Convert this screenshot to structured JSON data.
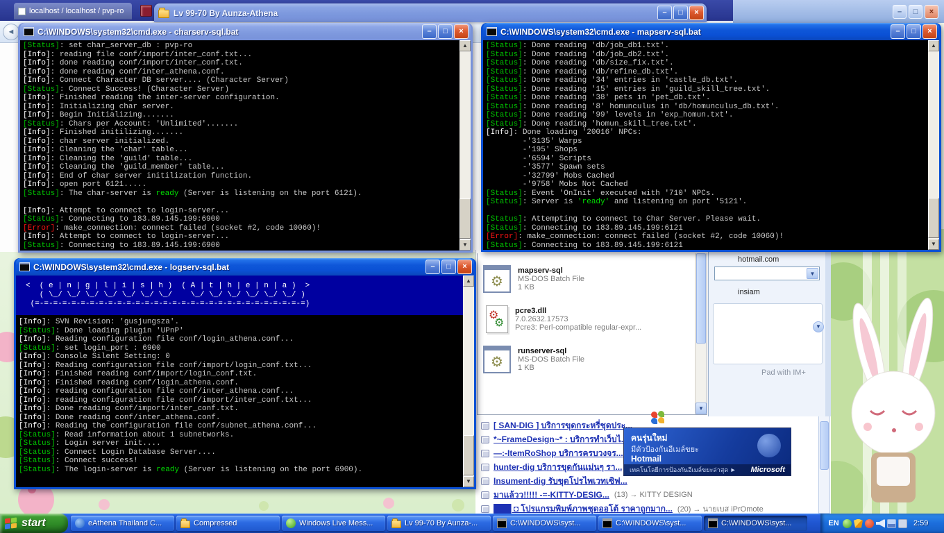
{
  "icons": {
    "minimize": "–",
    "maximize": "□",
    "close": "×",
    "scroll_up": "▲",
    "scroll_down": "▼",
    "combo_arrow": "▼",
    "back": "◄"
  },
  "browser": {
    "tab_label": "localhost / localhost / pvp-ro"
  },
  "explorer": {
    "title": "Lv 99-70 By Aunza-Athena"
  },
  "consoles": {
    "charserv": {
      "title": "C:\\WINDOWS\\system32\\cmd.exe - charserv-sql.bat",
      "lines": [
        {
          "t": "Status",
          "s": "set char_server_db : pvp-ro"
        },
        {
          "t": "Info",
          "s": "reading file conf/import/inter_conf.txt..."
        },
        {
          "t": "Info",
          "s": "done reading conf/import/inter_conf.txt."
        },
        {
          "t": "Info",
          "s": "done reading conf/inter_athena.conf."
        },
        {
          "t": "Info",
          "s": "Connect Character DB server.... (Character Server)"
        },
        {
          "t": "Status",
          "s": "Connect Success! (Character Server)"
        },
        {
          "t": "Info",
          "s": "Finished reading the inter-server configuration."
        },
        {
          "t": "Info",
          "s": "Initializing char server."
        },
        {
          "t": "Info",
          "s": "Begin Initializing......."
        },
        {
          "t": "Status",
          "s": "Chars per Account: 'Unlimited'......."
        },
        {
          "t": "Info",
          "s": "Finished initilizing......."
        },
        {
          "t": "Info",
          "s": "char server initialized."
        },
        {
          "t": "Info",
          "s": "Cleaning the 'char' table..."
        },
        {
          "t": "Info",
          "s": "Cleaning the 'guild' table..."
        },
        {
          "t": "Info",
          "s": "Cleaning the 'guild_member' table..."
        },
        {
          "t": "Info",
          "s": "End of char server initilization function."
        },
        {
          "t": "Info",
          "s": "open port 6121....."
        },
        {
          "t": "Status",
          "s": "The char-server is ready (Server is listening on the port 6121).",
          "g": "ready"
        },
        {
          "t": "",
          "s": ""
        },
        {
          "t": "Info",
          "s": "Attempt to connect to login-server..."
        },
        {
          "t": "Status",
          "s": "Connecting to 183.89.145.199:6900"
        },
        {
          "t": "Error",
          "s": "make_connection: connect failed (socket #2, code 10060)!"
        },
        {
          "t": "Info",
          "s": "Attempt to connect to login-server..."
        },
        {
          "t": "Status",
          "s": "Connecting to 183.89.145.199:6900"
        }
      ]
    },
    "mapserv": {
      "title": "C:\\WINDOWS\\system32\\cmd.exe - mapserv-sql.bat",
      "lines": [
        {
          "t": "Status",
          "s": "Done reading 'db/job_db1.txt'."
        },
        {
          "t": "Status",
          "s": "Done reading 'db/job_db2.txt'."
        },
        {
          "t": "Status",
          "s": "Done reading 'db/size_fix.txt'."
        },
        {
          "t": "Status",
          "s": "Done reading 'db/refine_db.txt'."
        },
        {
          "t": "Status",
          "s": "Done reading '34' entries in 'castle_db.txt'."
        },
        {
          "t": "Status",
          "s": "Done reading '15' entries in 'guild_skill_tree.txt'."
        },
        {
          "t": "Status",
          "s": "Done reading '38' pets in 'pet_db.txt'."
        },
        {
          "t": "Status",
          "s": "Done reading '8' homunculus in 'db/homunculus_db.txt'."
        },
        {
          "t": "Status",
          "s": "Done reading '99' levels in 'exp_homun.txt'."
        },
        {
          "t": "Status",
          "s": "Done reading 'homun_skill_tree.txt'."
        },
        {
          "t": "Info",
          "s": "Done loading '20016' NPCs:"
        },
        {
          "t": "",
          "s": "        -'3135' Warps"
        },
        {
          "t": "",
          "s": "        -'195' Shops"
        },
        {
          "t": "",
          "s": "        -'6594' Scripts"
        },
        {
          "t": "",
          "s": "        -'3577' Spawn sets"
        },
        {
          "t": "",
          "s": "        -'32799' Mobs Cached"
        },
        {
          "t": "",
          "s": "        -'9758' Mobs Not Cached"
        },
        {
          "t": "Status",
          "s": "Event 'OnInit' executed with '710' NPCs."
        },
        {
          "t": "Status",
          "s": "Server is 'ready' and listening on port '5121'.",
          "g": "'ready'"
        },
        {
          "t": "",
          "s": ""
        },
        {
          "t": "Status",
          "s": "Attempting to connect to Char Server. Please wait."
        },
        {
          "t": "Status",
          "s": "Connecting to 183.89.145.199:6121"
        },
        {
          "t": "Error",
          "s": "make_connection: connect failed (socket #2, code 10060)!"
        },
        {
          "t": "Status",
          "s": "Connecting to 183.89.145.199:6121"
        }
      ]
    },
    "logserv": {
      "title": "C:\\WINDOWS\\system32\\cmd.exe - logserv-sql.bat",
      "banner": [
        "<  ( e | n | g | l | i | s | h )  ( A | t | h | e | n | a )  >",
        "   ( \\_/ \\_/ \\_/ \\_/ \\_/ \\_/ \\_/    \\_/ \\_/ \\_/ \\_/ \\_/ \\_/ )",
        " (=-=-=-=-=-=-=-=-=-=-=-=-=-=-=-=-=-=-=-=-=-=-=-=-=-=-=-=-=-=)"
      ],
      "lines": [
        {
          "t": "Info",
          "s": "SVN Revision: 'gusjungsza'."
        },
        {
          "t": "Status",
          "s": "Done loading plugin 'UPnP'"
        },
        {
          "t": "Info",
          "s": "Reading configuration file conf/login_athena.conf..."
        },
        {
          "t": "Status",
          "s": "set login_port : 6900"
        },
        {
          "t": "Info",
          "s": "Console Silent Setting: 0"
        },
        {
          "t": "Info",
          "s": "Reading configuration file conf/import/login_conf.txt..."
        },
        {
          "t": "Info",
          "s": "Finished reading conf/import/login_conf.txt."
        },
        {
          "t": "Info",
          "s": "Finished reading conf/login_athena.conf."
        },
        {
          "t": "Info",
          "s": "reading configuration file conf/inter_athena.conf..."
        },
        {
          "t": "Info",
          "s": "reading configuration file conf/import/inter_conf.txt..."
        },
        {
          "t": "Info",
          "s": "Done reading conf/import/inter_conf.txt."
        },
        {
          "t": "Info",
          "s": "Done reading conf/inter_athena.conf."
        },
        {
          "t": "Info",
          "s": "Reading the configuration file conf/subnet_athena.conf..."
        },
        {
          "t": "Status",
          "s": "Read information about 1 subnetworks."
        },
        {
          "t": "Status",
          "s": "Login server init...."
        },
        {
          "t": "Status",
          "s": "Connect Login Database Server...."
        },
        {
          "t": "Status",
          "s": "Connect success!"
        },
        {
          "t": "Status",
          "s": "The login-server is ready (Server is listening on the port 6900).",
          "g": "ready"
        }
      ]
    }
  },
  "file_panel": {
    "files": [
      {
        "name": "mapserv-sql",
        "line2": "MS-DOS Batch File",
        "line3": "1 KB",
        "icon": "batch"
      },
      {
        "name": "pcre3.dll",
        "line2": "7.0.2632.17573",
        "line3": "Pcre3: Perl-compatible regular-expr...",
        "icon": "dll"
      },
      {
        "name": "runserver-sql",
        "line2": "MS-DOS Batch File",
        "line3": "1 KB",
        "icon": "batch"
      }
    ]
  },
  "messenger": {
    "email": "hotmail.com",
    "name": "insiam",
    "note": "Pad with IM+"
  },
  "forum_links": [
    {
      "text": "[ SAN-DIG ] บริการขุดกระหรี่ชุดประ...",
      "suffix": ""
    },
    {
      "text": "*~FrameDesign~* : บริการทำเว็บไ...",
      "suffix": ""
    },
    {
      "text": "—:-ItemRoShop บริการครบวงจร...",
      "suffix": ""
    },
    {
      "text": "hunter-dig บริการขุดกันแม่นๆ รา...",
      "suffix": ""
    },
    {
      "text": "Insument-dig รับขุดโปรไพเวทเซิฟ...",
      "suffix": ""
    },
    {
      "text": "มาแล้วว!!!!! -=-KITTY-DESIG...",
      "suffix": "(13) → KITTY DESIGN"
    },
    {
      "text": "███ ◘ โปรแกรมพิมพ์ภาพชุดออโต้ ราคาถูกมาก...",
      "suffix": "(20) → นายเบส iPrOmote"
    }
  ],
  "hotmail_ad": {
    "line1": "คนรุ่นใหม่",
    "line2": "มีตัวป้องกันอีเมล์ขยะ",
    "brand": "Hotmail",
    "tagline": "เทคโนโลยีการป้องกันอีเมล์ขยะล่าสุด ►",
    "ms": "Microsoft"
  },
  "taskbar": {
    "start_label": "start",
    "buttons": [
      {
        "label": "eAthena Thailand C...",
        "icon": "ie"
      },
      {
        "label": "Compressed",
        "icon": "folder"
      },
      {
        "label": "Windows Live Mess...",
        "icon": "messenger"
      },
      {
        "label": "Lv 99-70 By Aunza-...",
        "icon": "folder"
      },
      {
        "label": "C:\\WINDOWS\\syst...",
        "icon": "cmd"
      },
      {
        "label": "C:\\WINDOWS\\syst...",
        "icon": "cmd"
      },
      {
        "label": "C:\\WINDOWS\\syst...",
        "icon": "cmd",
        "active": true
      }
    ],
    "tray": {
      "lang": "EN",
      "icons": [
        "messenger",
        "shield",
        "update",
        "volume",
        "network",
        "usb"
      ],
      "time": "2:59"
    }
  }
}
